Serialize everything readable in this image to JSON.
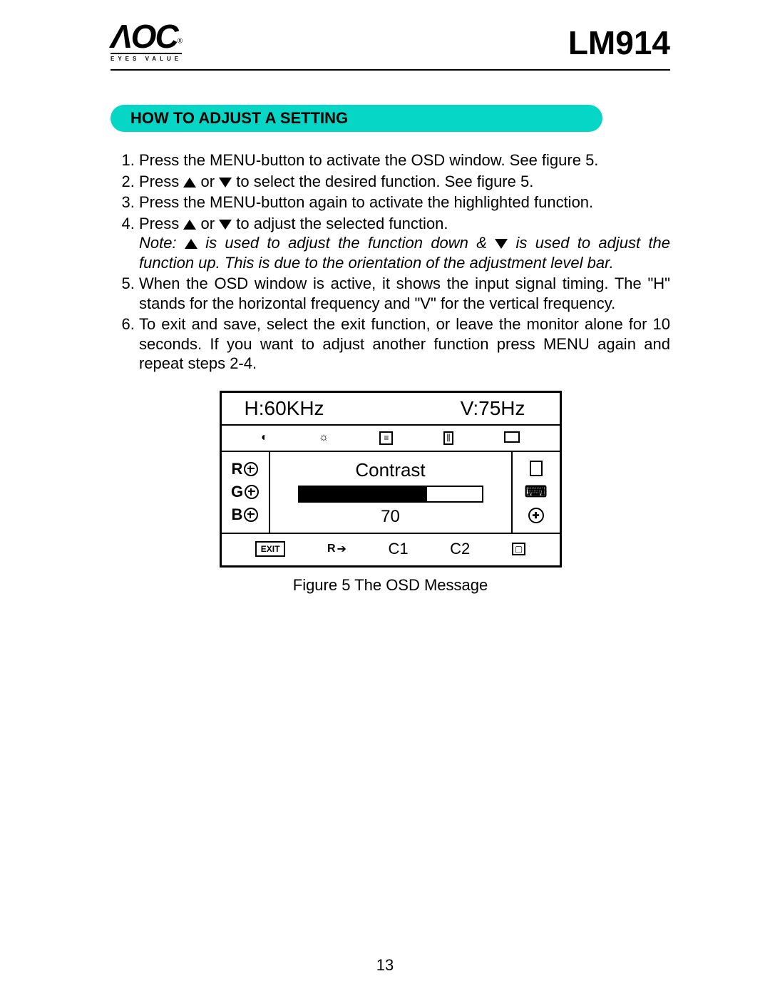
{
  "header": {
    "brand_main": "ΛOC",
    "brand_reg": "®",
    "brand_sub": "EYES VALUE",
    "model": "LM914"
  },
  "section_title": "HOW TO ADJUST A SETTING",
  "steps": {
    "s1": "Press the MENU-button  to activate the OSD window. See figure 5.",
    "s2a": "Press ",
    "s2b": "  or  ",
    "s2c": " to select the desired function. See figure 5.",
    "s3": "Press the MENU-button again to activate the highlighted function.",
    "s4a": "Press ",
    "s4b": "  or  ",
    "s4c": " to adjust the selected function.",
    "note_a": "Note: ",
    "note_b": " is used to adjust the function down & ",
    "note_c": "  is used to adjust the function up.  This is due to the orientation of the adjustment level bar.",
    "s5": "When the OSD window is active, it shows the input signal timing. The  \"H\" stands for the horizontal frequency and \"V\" for the vertical frequency.",
    "s6": "To exit and save, select the exit function, or leave the monitor alone for 10 seconds. If you want to adjust another function press MENU again and repeat steps 2-4."
  },
  "osd": {
    "h_label": "H:60KHz",
    "v_label": "V:75Hz",
    "left_R": "R",
    "left_G": "G",
    "left_B": "B",
    "func_name": "Contrast",
    "value": "70",
    "value_pct": 70,
    "exit": "EXIT",
    "bottom_r": "R",
    "c1": "C1",
    "c2": "C2"
  },
  "figure_caption": "Figure 5     The  OSD  Message",
  "page_number": "13"
}
